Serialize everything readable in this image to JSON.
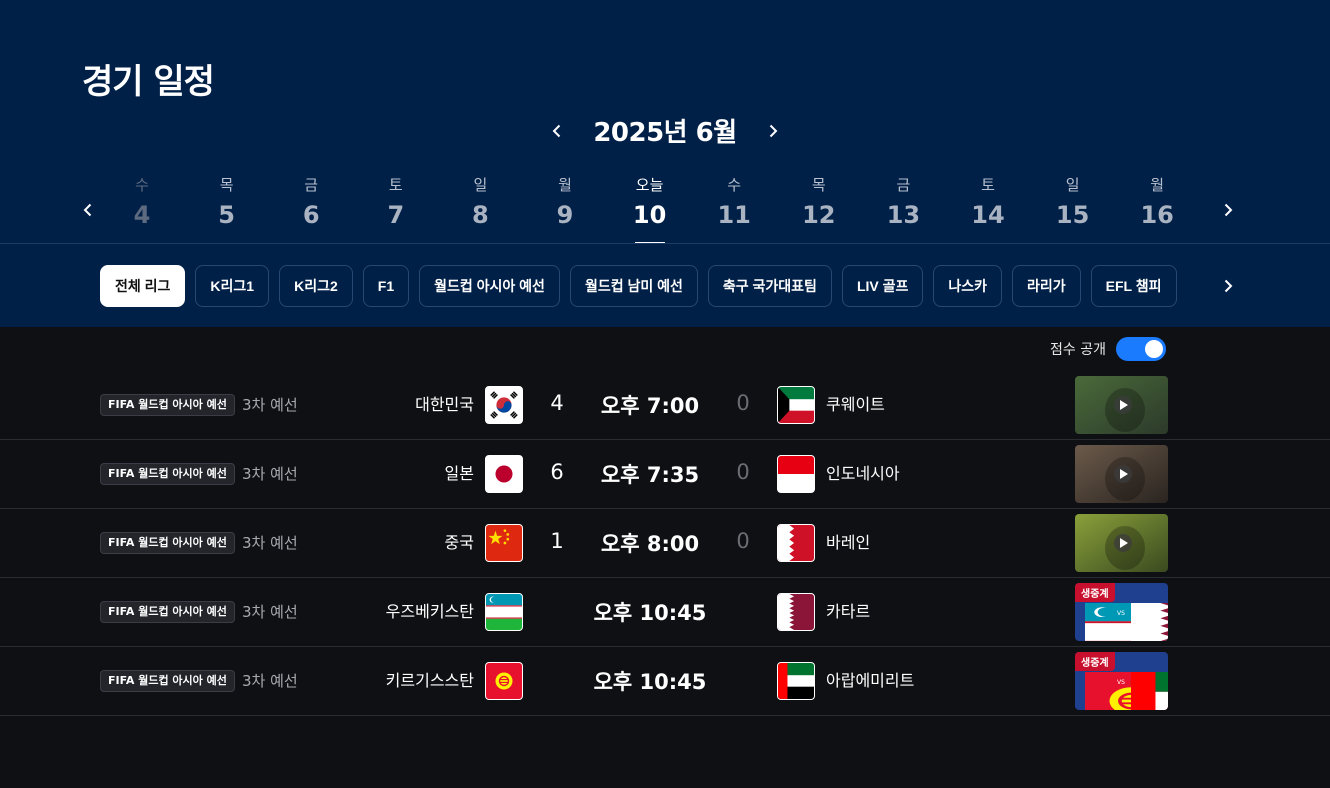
{
  "page": {
    "title": "경기 일정"
  },
  "month_nav": {
    "label": "2025년 6월"
  },
  "days": [
    {
      "weekday": "수",
      "date": "4",
      "state": "past"
    },
    {
      "weekday": "목",
      "date": "5",
      "state": "normal"
    },
    {
      "weekday": "금",
      "date": "6",
      "state": "normal"
    },
    {
      "weekday": "토",
      "date": "7",
      "state": "normal"
    },
    {
      "weekday": "일",
      "date": "8",
      "state": "normal"
    },
    {
      "weekday": "월",
      "date": "9",
      "state": "normal"
    },
    {
      "weekday": "오늘",
      "date": "10",
      "state": "today"
    },
    {
      "weekday": "수",
      "date": "11",
      "state": "normal"
    },
    {
      "weekday": "목",
      "date": "12",
      "state": "normal"
    },
    {
      "weekday": "금",
      "date": "13",
      "state": "normal"
    },
    {
      "weekday": "토",
      "date": "14",
      "state": "normal"
    },
    {
      "weekday": "일",
      "date": "15",
      "state": "normal"
    },
    {
      "weekday": "월",
      "date": "16",
      "state": "normal"
    }
  ],
  "leagues": [
    {
      "label": "전체 리그",
      "active": true
    },
    {
      "label": "K리그1"
    },
    {
      "label": "K리그2"
    },
    {
      "label": "F1"
    },
    {
      "label": "월드컵 아시아 예선"
    },
    {
      "label": "월드컵 남미 예선"
    },
    {
      "label": "축구 국가대표팀"
    },
    {
      "label": "LIV 골프"
    },
    {
      "label": "나스카"
    },
    {
      "label": "라리가"
    },
    {
      "label": "EFL 챔피"
    }
  ],
  "score_toggle": {
    "label": "점수 공개",
    "on": true
  },
  "matches": [
    {
      "competition": "FIFA 월드컵 아시아 예선",
      "round": "3차 예선",
      "home": "대한민국",
      "home_flag": "kr-flag",
      "home_score": "4",
      "time": "오후 7:00",
      "away_score": "0",
      "away": "쿠웨이트",
      "away_flag": "kw-flag",
      "thumb": "highlight-video",
      "live": ""
    },
    {
      "competition": "FIFA 월드컵 아시아 예선",
      "round": "3차 예선",
      "home": "일본",
      "home_flag": "jp-flag",
      "home_score": "6",
      "time": "오후 7:35",
      "away_score": "0",
      "away": "인도네시아",
      "away_flag": "id-flag",
      "thumb": "highlight-video",
      "live": ""
    },
    {
      "competition": "FIFA 월드컵 아시아 예선",
      "round": "3차 예선",
      "home": "중국",
      "home_flag": "cn-flag",
      "home_score": "1",
      "time": "오후 8:00",
      "away_score": "0",
      "away": "바레인",
      "away_flag": "bh-flag",
      "thumb": "highlight-video",
      "live": ""
    },
    {
      "competition": "FIFA 월드컵 아시아 예선",
      "round": "3차 예선",
      "home": "우즈베키스탄",
      "home_flag": "uz-flag",
      "home_score": "",
      "time": "오후 10:45",
      "away_score": "",
      "away": "카타르",
      "away_flag": "qa-flag",
      "thumb": "live-poster",
      "live": "생중계"
    },
    {
      "competition": "FIFA 월드컵 아시아 예선",
      "round": "3차 예선",
      "home": "키르기스스탄",
      "home_flag": "kg-flag",
      "home_score": "",
      "time": "오후 10:45",
      "away_score": "",
      "away": "아랍에미리트",
      "away_flag": "ae-flag",
      "thumb": "live-poster",
      "live": "생중계"
    }
  ]
}
